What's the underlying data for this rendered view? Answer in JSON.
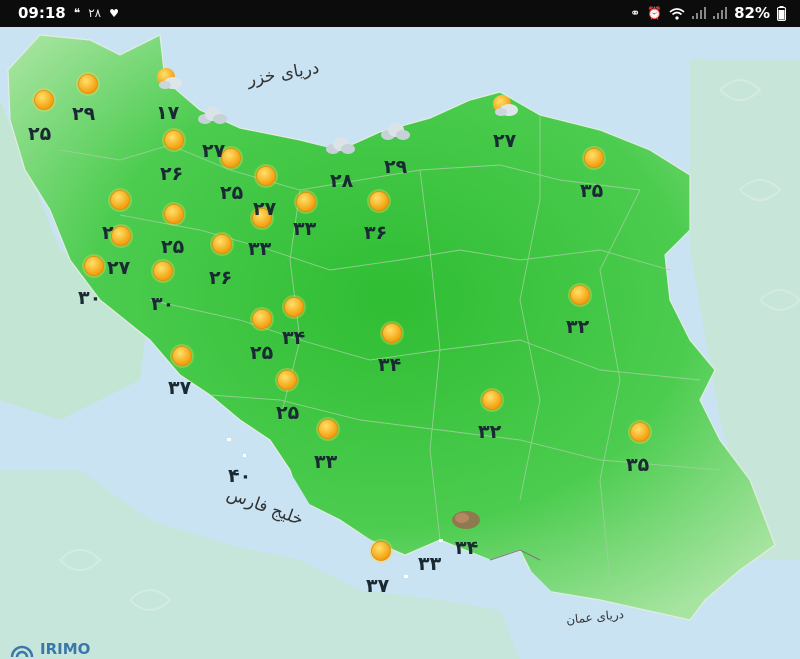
{
  "status_bar": {
    "time": "09:18",
    "notification_count": "۲۸",
    "battery": "82%"
  },
  "map": {
    "seas": {
      "caspian": "دریای خزر",
      "persian_gulf": "خلیج فارس",
      "oman": "دریای عمان"
    },
    "watermark": "IRIMO",
    "colors": {
      "land": "#46c84a",
      "sea": "#c9e3f3",
      "sun": "#f7a20c"
    },
    "stations": [
      {
        "temp": "۲۵",
        "icon": "sun-icon"
      },
      {
        "temp": "۲۹",
        "icon": "sun-icon"
      },
      {
        "temp": "۱۷",
        "icon": "partly-cloudy-icon"
      },
      {
        "temp": "۲۷",
        "icon": "cloud-icon"
      },
      {
        "temp": "۲۶",
        "icon": "sun-icon"
      },
      {
        "temp": "۲۵",
        "icon": "sun-icon"
      },
      {
        "temp": "۲۷",
        "icon": "sun-icon"
      },
      {
        "temp": "۲۸",
        "icon": "cloud-icon"
      },
      {
        "temp": "۲۹",
        "icon": "cloud-icon"
      },
      {
        "temp": "۲۷",
        "icon": "partly-cloudy-icon"
      },
      {
        "temp": "۳۵",
        "icon": "sun-icon"
      },
      {
        "temp": "۲",
        "icon": "sun-icon"
      },
      {
        "temp": "۲۵",
        "icon": "sun-icon"
      },
      {
        "temp": "۳۳",
        "icon": "sun-icon"
      },
      {
        "temp": "۳۳",
        "icon": "sun-icon"
      },
      {
        "temp": "۳۶",
        "icon": "sun-icon"
      },
      {
        "temp": "۲۷",
        "icon": "sun-icon"
      },
      {
        "temp": "۳۰",
        "icon": "sun-icon"
      },
      {
        "temp": "۳۰",
        "icon": "sun-icon"
      },
      {
        "temp": "۲۶",
        "icon": "sun-icon"
      },
      {
        "temp": "۳۴",
        "icon": "sun-icon"
      },
      {
        "temp": "۲۵",
        "icon": "sun-icon"
      },
      {
        "temp": "۳۴",
        "icon": "sun-icon"
      },
      {
        "temp": "۳۲",
        "icon": "sun-icon"
      },
      {
        "temp": "۳۷",
        "icon": "sun-icon"
      },
      {
        "temp": "۲۵",
        "icon": "sun-icon"
      },
      {
        "temp": "۳۲",
        "icon": "sun-icon"
      },
      {
        "temp": "۳۳",
        "icon": "sun-icon"
      },
      {
        "temp": "۳۵",
        "icon": "sun-icon"
      },
      {
        "temp": "۴۰",
        "icon": "none"
      },
      {
        "temp": "۳۴",
        "icon": "dust-icon"
      },
      {
        "temp": "۳۳",
        "icon": "none"
      },
      {
        "temp": "۳۷",
        "icon": "sun-icon"
      }
    ]
  }
}
